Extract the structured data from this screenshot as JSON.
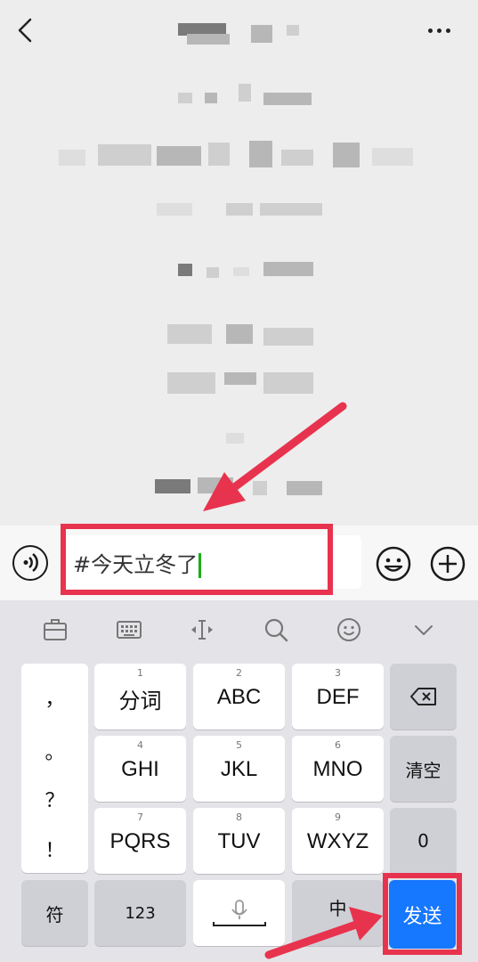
{
  "input": {
    "text": "#今天立冬了"
  },
  "keyboard": {
    "punctuation": [
      "，",
      "。",
      "？",
      "！"
    ],
    "rows": [
      [
        {
          "num": "1",
          "label": "分词"
        },
        {
          "num": "2",
          "label": "ABC"
        },
        {
          "num": "3",
          "label": "DEF"
        }
      ],
      [
        {
          "num": "4",
          "label": "GHI"
        },
        {
          "num": "5",
          "label": "JKL"
        },
        {
          "num": "6",
          "label": "MNO"
        }
      ],
      [
        {
          "num": "7",
          "label": "PQRS"
        },
        {
          "num": "8",
          "label": "TUV"
        },
        {
          "num": "9",
          "label": "WXYZ"
        }
      ]
    ],
    "clear_label": "清空",
    "zero_label": "0",
    "symbol_label": "符",
    "numeric_label": "123",
    "lang_label": "中",
    "send_label": "发送"
  },
  "colors": {
    "accent": "#1677ff",
    "annotation": "#e8334e",
    "caret": "#1aad19"
  }
}
